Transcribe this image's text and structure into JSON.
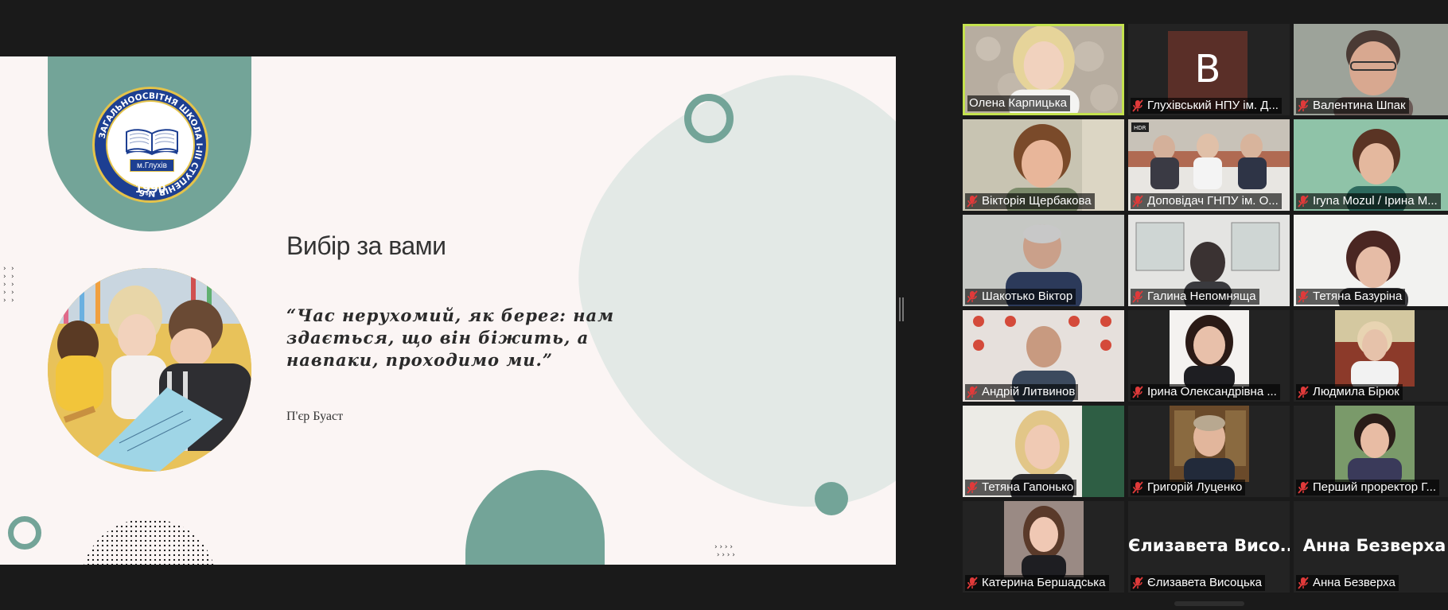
{
  "slide": {
    "title": "Вибір за вами",
    "quote": "“Час нерухомий, як берег: нам здається, що він біжить, а навпаки, проходимо ми.”",
    "author": "П'єр Буаст",
    "logo": {
      "ring_text": "ЗАГАЛЬНООСВІТНЯ ШКОЛА I-III СТУПЕНІВ №6",
      "city": "м.Глухів",
      "year": "1990"
    },
    "colors": {
      "accent": "#73a498",
      "background": "#fbf5f4",
      "blob": "#e3e9e6"
    }
  },
  "gallery": {
    "active_speaker_color": "#c4e24e",
    "participants": [
      {
        "name": "Олена Карпицька",
        "muted": false,
        "active": true,
        "kind": "video"
      },
      {
        "name": "Глухівський НПУ ім. Д...",
        "muted": true,
        "active": false,
        "kind": "avatar",
        "avatar_letter": "B",
        "avatar_color": "#5a2f28"
      },
      {
        "name": "Валентина Шпак",
        "muted": true,
        "active": false,
        "kind": "video"
      },
      {
        "name": "Вікторія Щербакова",
        "muted": true,
        "active": false,
        "kind": "video"
      },
      {
        "name": "Доповідач ГНПУ ім. О...",
        "muted": true,
        "active": false,
        "kind": "video",
        "badge": "HDR"
      },
      {
        "name": "Iryna Mozul / Ірина М...",
        "muted": true,
        "active": false,
        "kind": "video"
      },
      {
        "name": "Шакотько Віктор",
        "muted": true,
        "active": false,
        "kind": "video"
      },
      {
        "name": "Галина Непомняща",
        "muted": true,
        "active": false,
        "kind": "video"
      },
      {
        "name": "Тетяна Базуріна",
        "muted": true,
        "active": false,
        "kind": "video"
      },
      {
        "name": "Андрій Литвинов",
        "muted": true,
        "active": false,
        "kind": "video"
      },
      {
        "name": "Ірина Олександрівна ...",
        "muted": true,
        "active": false,
        "kind": "photo"
      },
      {
        "name": "Людмила Бірюк",
        "muted": true,
        "active": false,
        "kind": "photo"
      },
      {
        "name": "Тетяна Гапонько",
        "muted": true,
        "active": false,
        "kind": "video"
      },
      {
        "name": "Григорій Луценко",
        "muted": true,
        "active": false,
        "kind": "photo"
      },
      {
        "name": "Перший проректор Г...",
        "muted": true,
        "active": false,
        "kind": "photo"
      },
      {
        "name": "Катерина Бершадська",
        "muted": true,
        "active": false,
        "kind": "photo"
      },
      {
        "name": "Єлизавета Висоцька",
        "muted": true,
        "active": false,
        "kind": "text",
        "display_name": "Єлизавета  Висо..."
      },
      {
        "name": "Анна Безверха",
        "muted": true,
        "active": false,
        "kind": "text",
        "display_name": "Анна Безверха"
      }
    ]
  }
}
